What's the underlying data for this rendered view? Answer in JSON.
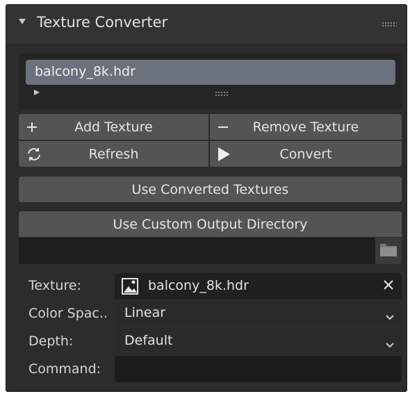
{
  "panel": {
    "title": "Texture Converter"
  },
  "texture_list": {
    "items": [
      "balcony_8k.hdr"
    ]
  },
  "buttons": {
    "add_texture": "Add Texture",
    "remove_texture": "Remove Texture",
    "refresh": "Refresh",
    "convert": "Convert",
    "use_converted": "Use Converted Textures",
    "use_custom_output": "Use Custom Output Directory"
  },
  "icons": {
    "add": "plus-icon",
    "remove": "minus-icon",
    "refresh": "refresh-icon",
    "convert": "play-icon",
    "folder": "folder-icon",
    "image": "image-icon",
    "clear": "close-icon",
    "dropdown": "chevron-down-icon"
  },
  "output_directory": {
    "value": ""
  },
  "properties": {
    "texture": {
      "label": "Texture:",
      "value": "balcony_8k.hdr"
    },
    "color_space": {
      "label": "Color Spac..",
      "value": "Linear"
    },
    "depth": {
      "label": "Depth:",
      "value": "Default"
    },
    "command": {
      "label": "Command:",
      "value": ""
    }
  },
  "colors": {
    "panel_bg": "#2c2c2c",
    "button_bg": "#545454",
    "selected_item": "#6b727d",
    "field_bg": "#1e1e1e"
  }
}
